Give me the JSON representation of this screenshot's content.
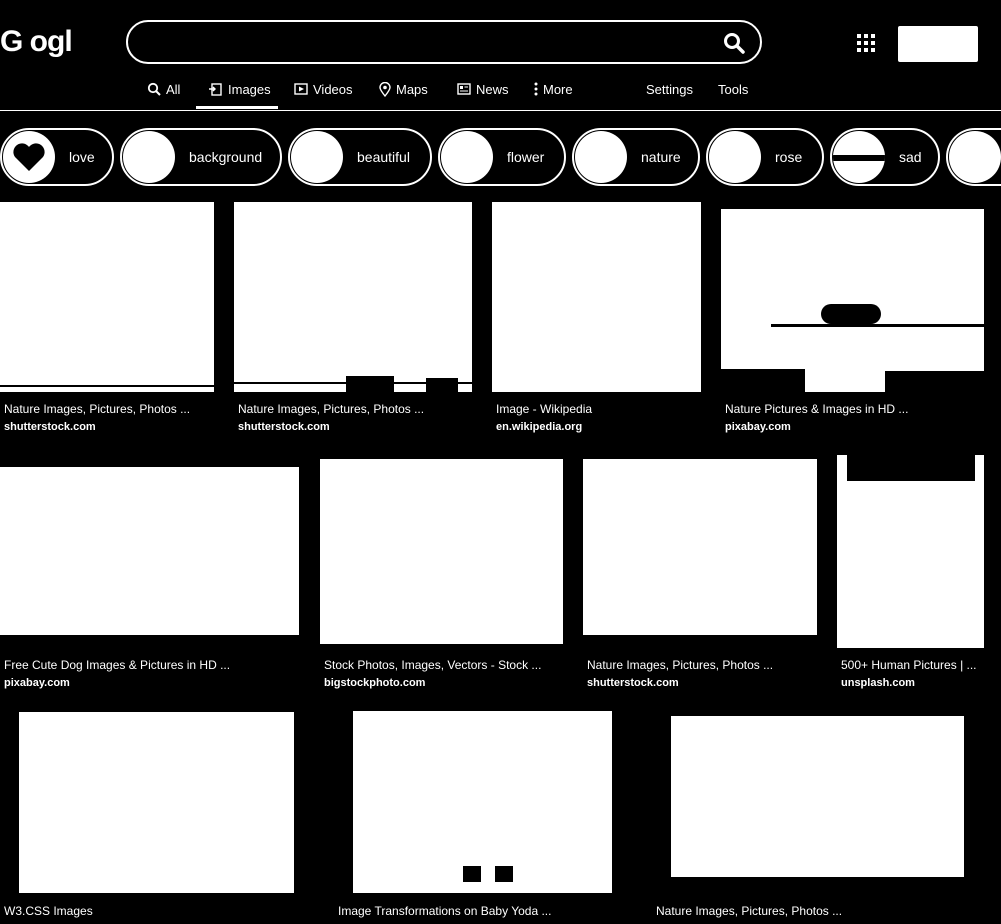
{
  "logo": "G ogl",
  "signin_label": "",
  "tabs": [
    "All",
    "Images",
    "Videos",
    "Maps",
    "News",
    "More",
    "Settings",
    "Tools"
  ],
  "chips": [
    "love",
    "background",
    "beautiful",
    "flower",
    "nature",
    "rose",
    "sad"
  ],
  "results": [
    {
      "title": "Nature Images, Pictures, Photos ...",
      "source": "shutterstock.com"
    },
    {
      "title": "Nature Images, Pictures, Photos ...",
      "source": "shutterstock.com"
    },
    {
      "title": "Image - Wikipedia",
      "source": "en.wikipedia.org"
    },
    {
      "title": "Nature Pictures & Images in HD ...",
      "source": "pixabay.com"
    },
    {
      "title": "Free Cute Dog Images & Pictures in HD ...",
      "source": "pixabay.com"
    },
    {
      "title": "Stock Photos, Images, Vectors - Stock ...",
      "source": "bigstockphoto.com"
    },
    {
      "title": "Nature Images, Pictures, Photos ...",
      "source": "shutterstock.com"
    },
    {
      "title": "500+ Human Pictures | ...",
      "source": "unsplash.com"
    },
    {
      "title": "W3.CSS Images",
      "source": ""
    },
    {
      "title": "Image Transformations on Baby Yoda ...",
      "source": ""
    },
    {
      "title": "Nature Images, Pictures, Photos ...",
      "source": ""
    }
  ],
  "colors": {
    "background": "#000000",
    "foreground": "#ffffff"
  }
}
